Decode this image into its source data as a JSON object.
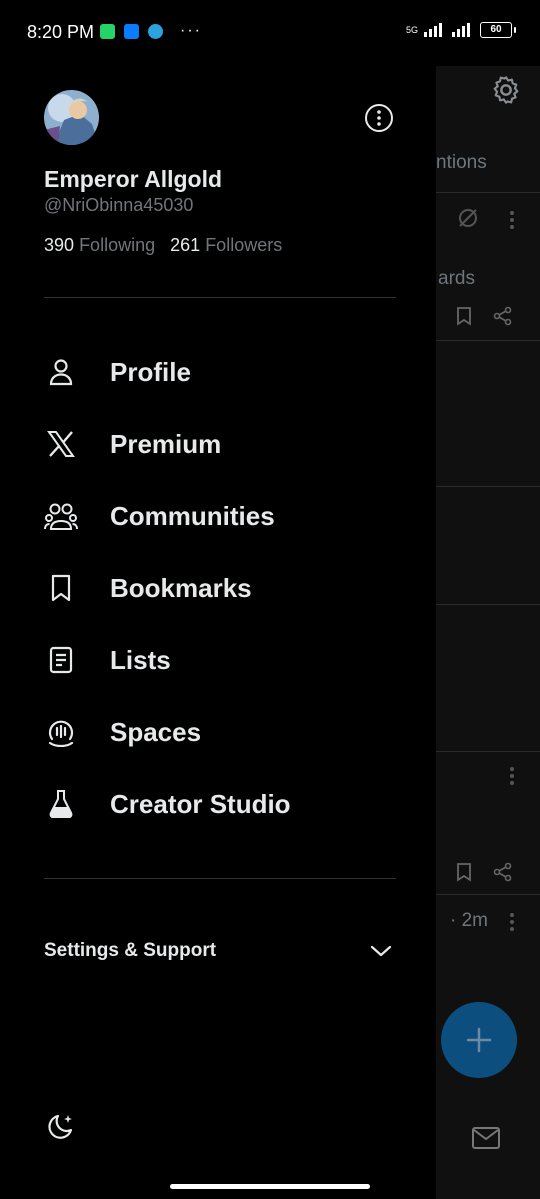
{
  "status_bar": {
    "time": "8:20 PM",
    "dots": "···",
    "network": "5G",
    "battery": "60",
    "app_icons": [
      {
        "name": "whatsapp-icon",
        "color": "#25d366"
      },
      {
        "name": "messenger-icon",
        "color": "#0a7cff"
      },
      {
        "name": "telegram-icon",
        "color": "#2aa3df"
      }
    ]
  },
  "background": {
    "tab_partial": "ntions",
    "rewards_partial": "ards",
    "time_partial": "· 2m"
  },
  "profile": {
    "name": "Emperor Allgold",
    "handle": "@NriObinna45030",
    "following_count": "390",
    "following_label": "Following",
    "followers_count": "261",
    "followers_label": "Followers"
  },
  "menu": [
    {
      "label": "Profile",
      "icon": "person-icon"
    },
    {
      "label": "Premium",
      "icon": "x-logo-icon"
    },
    {
      "label": "Communities",
      "icon": "communities-icon"
    },
    {
      "label": "Bookmarks",
      "icon": "bookmark-icon"
    },
    {
      "label": "Lists",
      "icon": "list-icon"
    },
    {
      "label": "Spaces",
      "icon": "spaces-icon"
    },
    {
      "label": "Creator Studio",
      "icon": "flask-icon"
    }
  ],
  "settings": {
    "label": "Settings & Support"
  },
  "colors": {
    "background": "#000000",
    "text": "#e7e9ea",
    "muted": "#71767b",
    "fab": "#0c4f7e"
  }
}
